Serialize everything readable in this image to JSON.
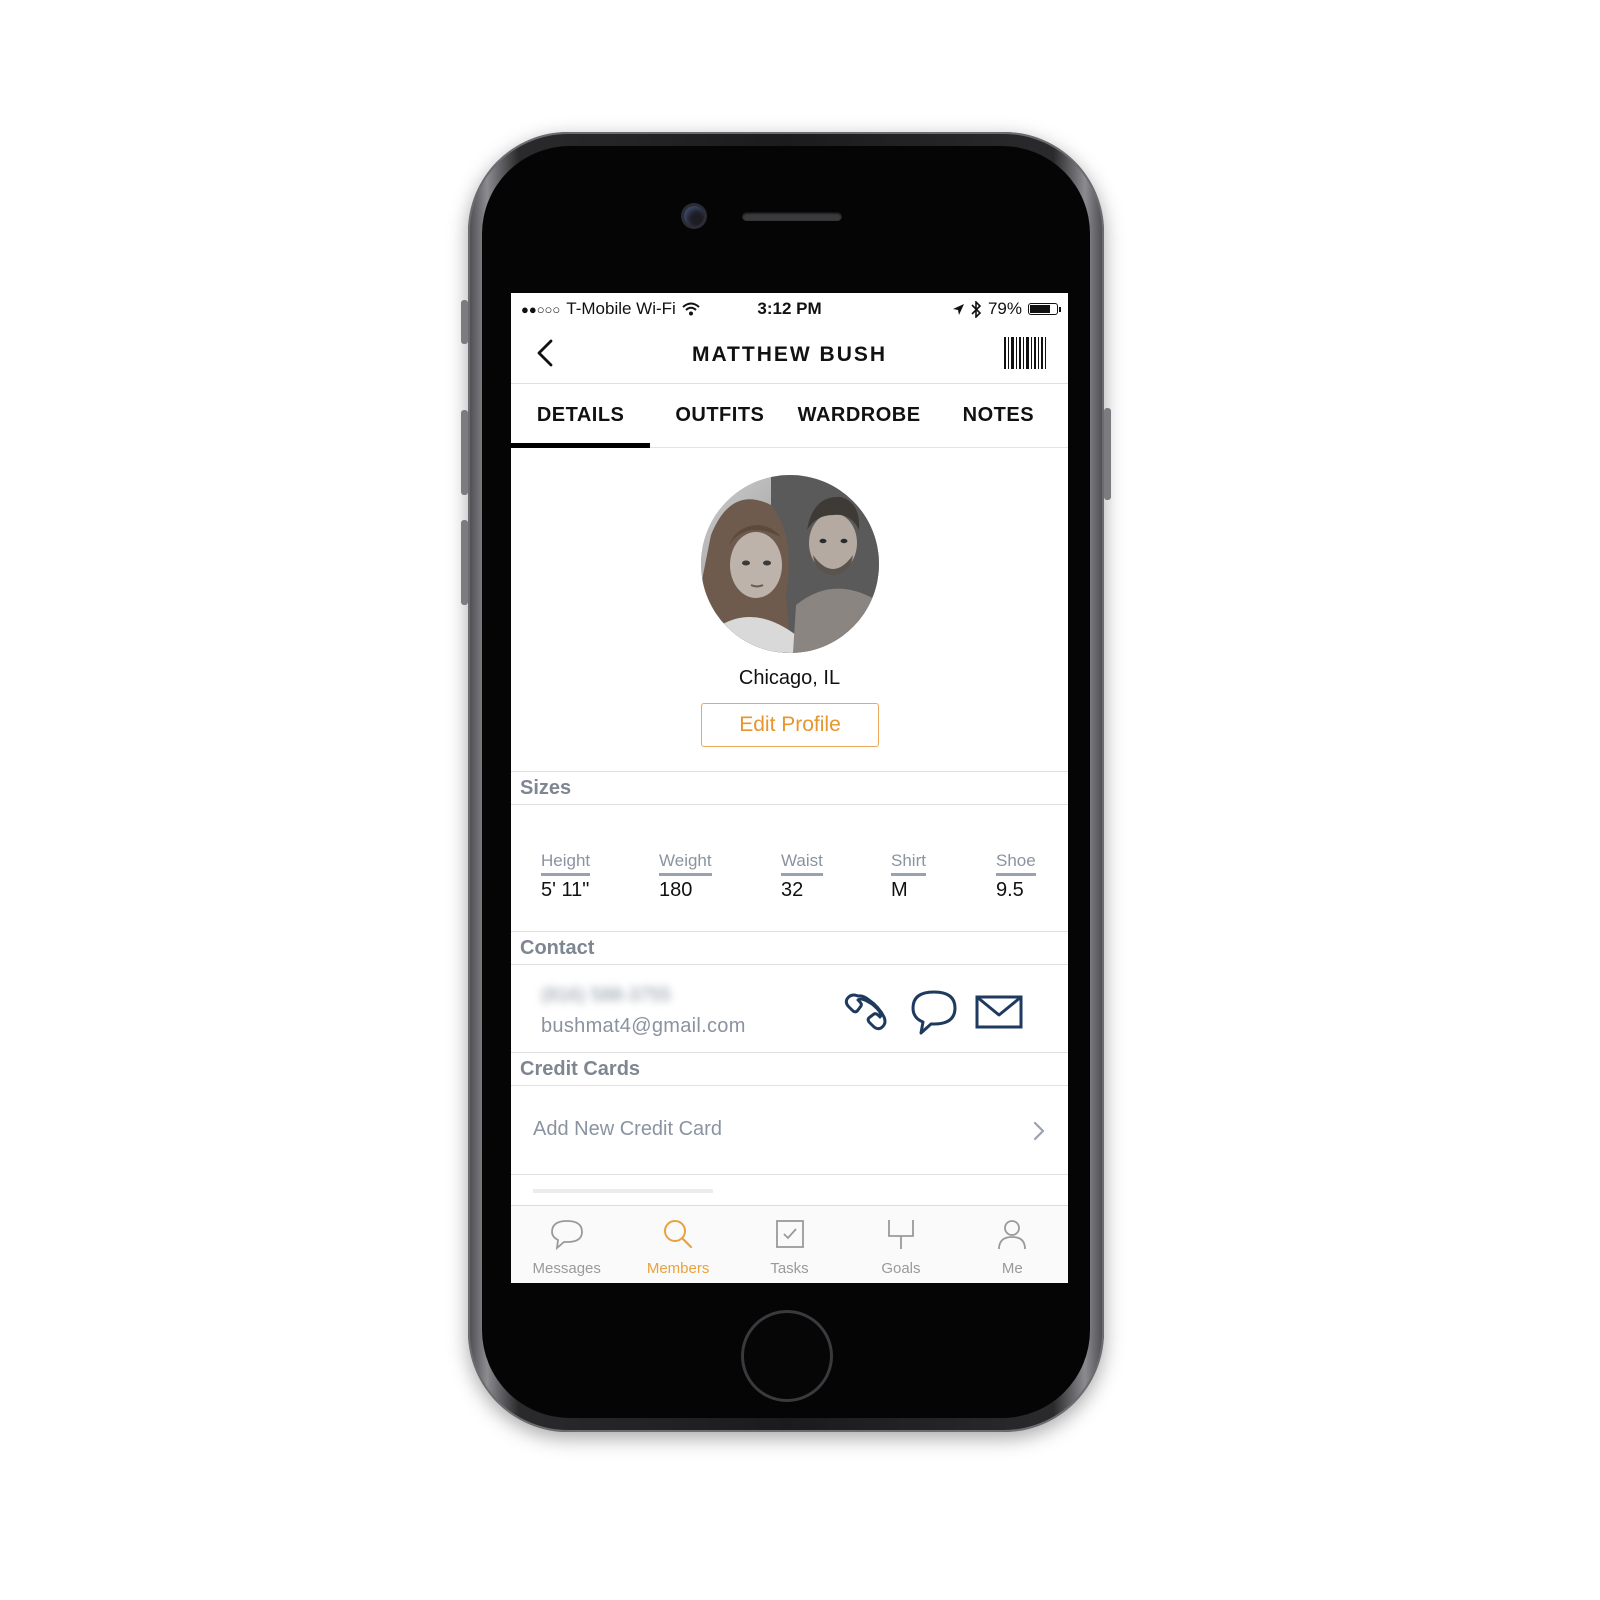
{
  "status_bar": {
    "signal": "●●○○○",
    "carrier": "T-Mobile Wi-Fi",
    "time": "3:12 PM",
    "battery": "79%",
    "battery_level": 0.79
  },
  "header": {
    "title": "MATTHEW BUSH"
  },
  "tabs": [
    {
      "label": "DETAILS",
      "active": true
    },
    {
      "label": "OUTFITS",
      "active": false
    },
    {
      "label": "WARDROBE",
      "active": false
    },
    {
      "label": "NOTES",
      "active": false
    }
  ],
  "profile": {
    "location": "Chicago, IL",
    "edit_button": "Edit Profile"
  },
  "sizes": {
    "header": "Sizes",
    "items": [
      {
        "label": "Height",
        "value": "5' 11\""
      },
      {
        "label": "Weight",
        "value": "180"
      },
      {
        "label": "Waist",
        "value": "32"
      },
      {
        "label": "Shirt",
        "value": "M"
      },
      {
        "label": "Shoe",
        "value": "9.5"
      }
    ]
  },
  "contact": {
    "header": "Contact",
    "phone_blurred": "(816) 588-3755",
    "email": "bushmat4@gmail.com"
  },
  "credit_cards": {
    "header": "Credit Cards",
    "add_label": "Add New Credit Card"
  },
  "tabbar": [
    {
      "label": "Messages",
      "icon": "chat-bubble-icon",
      "active": false
    },
    {
      "label": "Members",
      "icon": "search-icon",
      "active": true
    },
    {
      "label": "Tasks",
      "icon": "checkbox-icon",
      "active": false
    },
    {
      "label": "Goals",
      "icon": "goalpost-icon",
      "active": false
    },
    {
      "label": "Me",
      "icon": "person-icon",
      "active": false
    }
  ],
  "colors": {
    "accent": "#e9a23c",
    "icon_navy": "#1f3a5f",
    "muted_text": "#8a93a0"
  }
}
